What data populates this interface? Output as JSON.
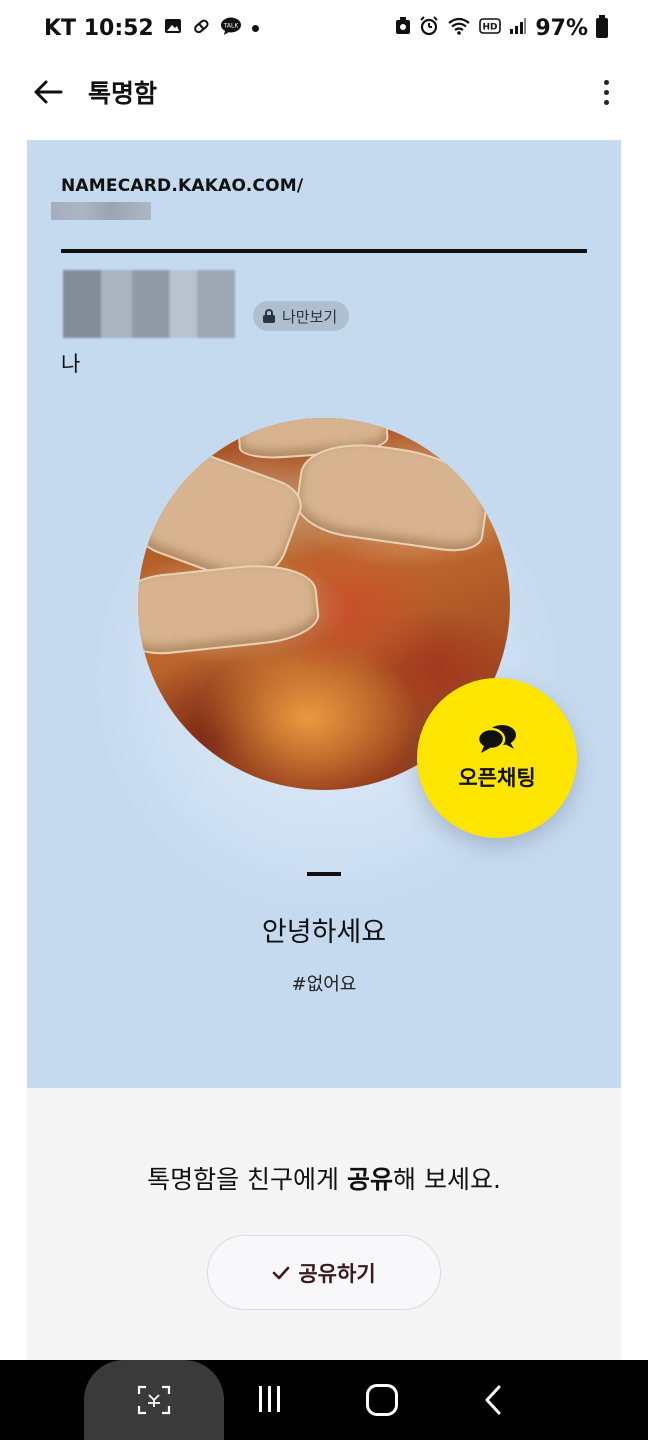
{
  "status_bar": {
    "carrier_time": "KT 10:52",
    "battery": "97%",
    "icons": [
      "gallery-icon",
      "pill-icon",
      "kakaotalk-icon",
      "dot-icon",
      "recycle-icon",
      "alarm-icon",
      "wifi-icon",
      "hd-icon",
      "signal-icon",
      "battery-icon"
    ]
  },
  "app_bar": {
    "title": "톡명함",
    "back_icon": "arrow-left-icon",
    "more_icon": "more-vertical-icon"
  },
  "card": {
    "background_color": "#c6daef",
    "url": "NAMECARD.KAKAO.COM/",
    "private_badge": "나만보기",
    "me_label": "나",
    "open_chat_label": "오픈채팅",
    "open_chat_color": "#fee500",
    "status_message": "안녕하세요",
    "hashtag": "#없어요"
  },
  "share": {
    "prompt_before": "톡명함을 친구에게 ",
    "prompt_bold": "공유",
    "prompt_after": "해 보세요.",
    "button_label": "공유하기"
  },
  "nav_bar": {
    "buttons": [
      "screen-capture-icon",
      "recent-apps-icon",
      "home-icon",
      "back-icon"
    ]
  }
}
